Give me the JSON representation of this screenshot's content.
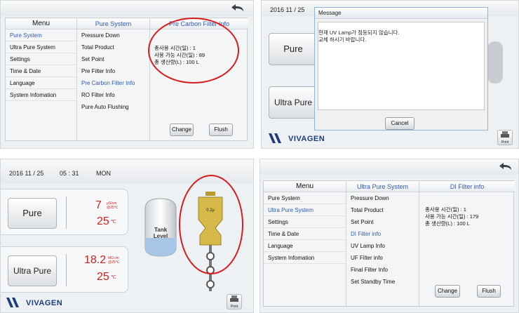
{
  "panel1": {
    "menu_title": "Menu",
    "menu_items": [
      "Pure System",
      "Ultra Pure System",
      "Settings",
      "Time & Date",
      "Language",
      "System Infomation"
    ],
    "sub_title": "Pure System",
    "sub_items": [
      "Pressure Down",
      "Total Product",
      "Set Point",
      "Pre Filter Info",
      "Pre Carbon Filter Info",
      "RO Filter Info",
      "Pure Auto Flushing"
    ],
    "info_title": "Pre Carbon Filter Info",
    "info_lines": [
      "총사용 시간(일) : 1",
      "사용 가능 시간(일) : 89",
      "총 생산량(L) : 100 L"
    ],
    "change_label": "Change",
    "flush_label": "Flush"
  },
  "panel2": {
    "date": "2016  11 / 25",
    "pure_label": "Pure",
    "ultra_label": "Ultra Pure",
    "dialog_title": "Message",
    "dialog_lines": [
      "현재 UV Lamp가 점등되지 않습니다.",
      "교체 하시기 바랍니다."
    ],
    "cancel_label": "Cancel",
    "logo": "VIVAGEN",
    "print_label": "Print"
  },
  "panel3": {
    "date": "2016  11 / 25",
    "time": "05 : 31",
    "day": "MON",
    "pure_label": "Pure",
    "pure_value": "7",
    "pure_unit_top": "μS/cm",
    "pure_unit_bottom": "@25℃",
    "pure_temp": "25",
    "pure_temp_unit": "℃",
    "ultra_label": "Ultra Pure",
    "ultra_value": "18.2",
    "ultra_unit_top": "MΩ.cm",
    "ultra_unit_bottom": "@25℃",
    "ultra_temp": "25",
    "ultra_temp_unit": "℃",
    "tank_label_1": "Tank",
    "tank_label_2": "Level",
    "filter_label": "0.2μ",
    "logo": "VIVAGEN",
    "print_label": "Print"
  },
  "panel4": {
    "menu_title": "Menu",
    "menu_items": [
      "Pure System",
      "Ultra Pure System",
      "Settings",
      "Time & Date",
      "Language",
      "System Infomation"
    ],
    "sub_title": "Ultra Pure System",
    "sub_items": [
      "Pressure Down",
      "Total Product",
      "Set Point",
      "DI Filter info",
      "UV Lamp Info",
      "UF Filter info",
      "Final Filter Info",
      "Set Standby Time"
    ],
    "info_title": "DI Filter info",
    "info_lines": [
      "총사용 시간(일) : 1",
      "사용 가능 시간(일) : 179",
      "총 생산량(L) : 100 L"
    ],
    "change_label": "Change",
    "flush_label": "Flush"
  }
}
